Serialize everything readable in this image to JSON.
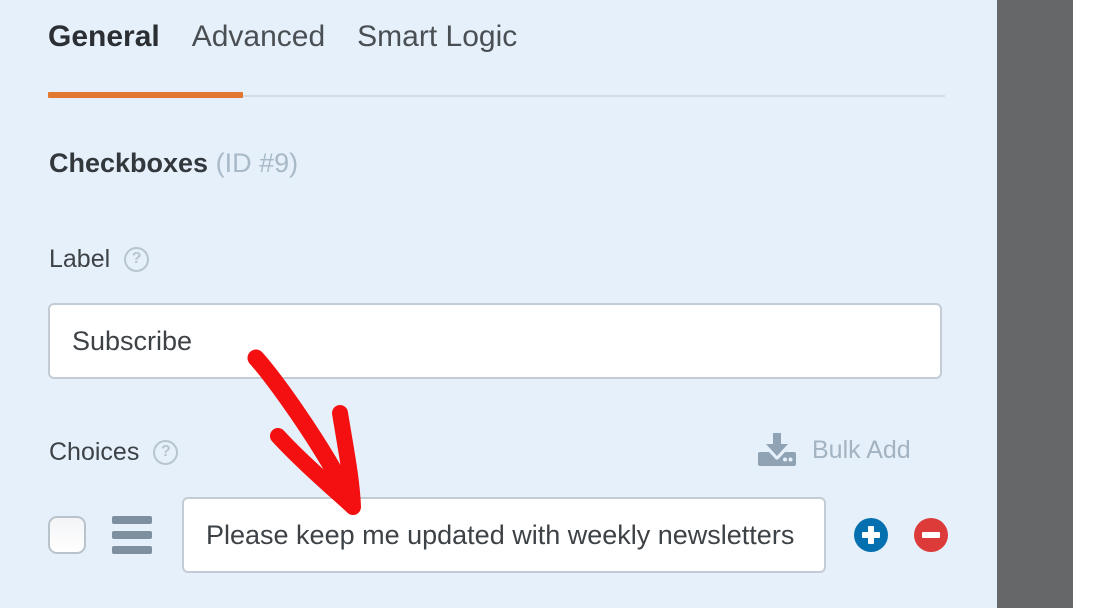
{
  "tabs": [
    {
      "label": "General",
      "active": true
    },
    {
      "label": "Advanced",
      "active": false
    },
    {
      "label": "Smart Logic",
      "active": false
    }
  ],
  "field": {
    "type_name": "Checkboxes",
    "id_text": "(ID #9)"
  },
  "label_section": {
    "title": "Label",
    "help_icon": "question-mark-icon",
    "help_glyph": "?",
    "value": "Subscribe"
  },
  "choices_section": {
    "title": "Choices",
    "help_icon": "question-mark-icon",
    "help_glyph": "?",
    "bulk_add": {
      "label": "Bulk Add",
      "icon": "import-download-icon"
    },
    "rows": [
      {
        "checked": false,
        "checkbox_icon": "unchecked-checkbox-icon",
        "drag_icon": "drag-handle-icon",
        "value": "Please keep me updated with weekly newsletters",
        "add_icon": "plus-circle-icon",
        "remove_icon": "minus-circle-icon"
      }
    ]
  },
  "annotation": {
    "type": "red-arrow",
    "color": "#f41010",
    "points_from": "label-input",
    "points_to": "choice-input"
  },
  "colors": {
    "panel_bg": "#e6f0fa",
    "accent_orange": "#e27730",
    "add_blue": "#0470b0",
    "remove_red": "#dd3a3a",
    "muted_text": "#a3b3c2",
    "side_gray": "#666768"
  }
}
